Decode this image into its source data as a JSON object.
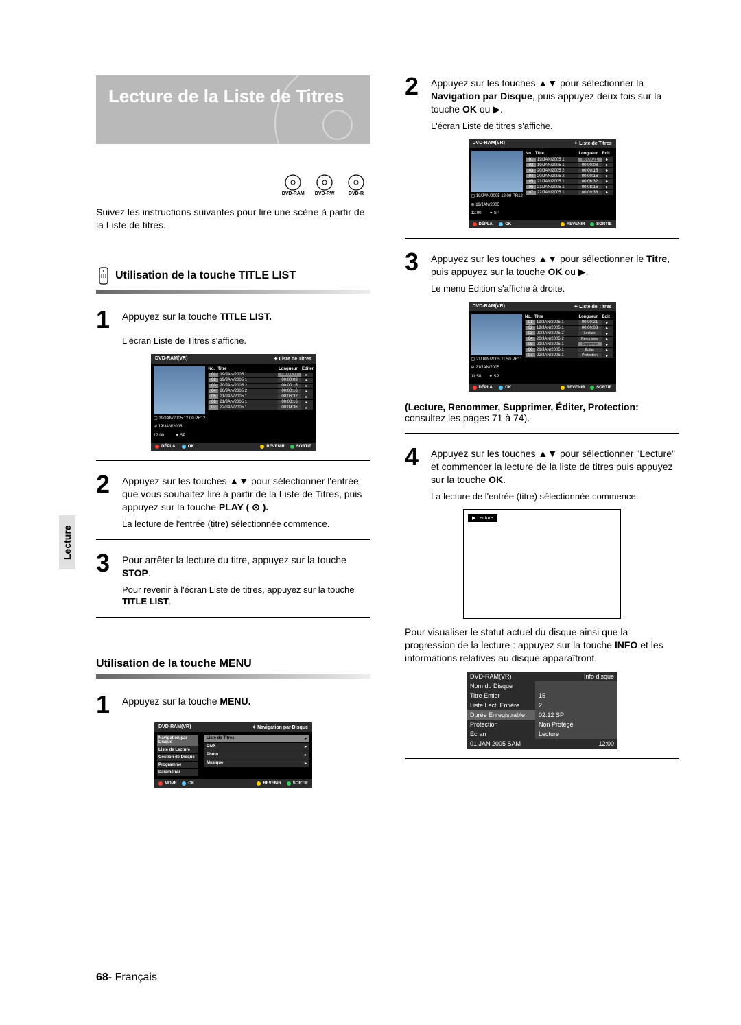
{
  "title": "Lecture de la Liste de Titres",
  "disc_icons": [
    "DVD-RAM",
    "DVD-RW",
    "DVD-R"
  ],
  "intro": "Suivez les instructions suivantes pour lire une scène à partir de la Liste de titres.",
  "section1": {
    "heading": "Utilisation de la touche TITLE LIST",
    "step1_pre": "Appuyez sur la touche ",
    "step1_bold": "TITLE LIST.",
    "step1_sub": "L'écran Liste de Titres s'affiche.",
    "step2": "Appuyez sur les touches ▲▼ pour sélectionner l'entrée que vous souhaitez lire à partir de la Liste de Titres, puis appuyez sur la touche ",
    "step2_bold": "PLAY ( ⊙ ).",
    "step2_sub": "La lecture de l'entrée (titre) sélectionnée commence.",
    "step3_a": "Pour arrêter la lecture du titre, appuyez sur la touche ",
    "step3_bold": "STOP",
    "step3_dot": ".",
    "step3_sub_a": "Pour revenir à l'écran Liste de titres, appuyez sur la touche ",
    "step3_sub_bold": "TITLE LIST",
    "step3_sub_dot": "."
  },
  "section2": {
    "heading": "Utilisation de la touche MENU",
    "step1_pre": "Appuyez sur la touche ",
    "step1_bold": "MENU."
  },
  "right": {
    "step2_a": "Appuyez sur les touches ▲▼ pour sélectionner la ",
    "step2_bold1": "Navigation par Disque",
    "step2_b": ", puis appuyez deux fois sur la touche ",
    "step2_bold2": "OK",
    "step2_c": " ou ▶.",
    "step2_sub": "L'écran Liste de titres s'affiche.",
    "step3_a": "Appuyez sur les touches ▲▼ pour sélectionner le ",
    "step3_bold1": "Titre",
    "step3_b": ", puis appuyez sur la touche ",
    "step3_bold2": "OK",
    "step3_c": " ou ▶.",
    "step3_sub": "Le menu Edition s'affiche à droite.",
    "actions_bold": "(Lecture, Renommer, Supprimer, Éditer, Protection:",
    "actions_rest": " consultez les pages 71 à 74).",
    "step4_a": "Appuyez sur les touches ▲▼ pour sélectionner \"Lecture\" et commencer la lecture de la liste de titres puis appuyez sur la touche ",
    "step4_bold": "OK",
    "step4_dot": ".",
    "step4_sub": "La lecture de l'entrée (titre) sélectionnée commence.",
    "post_play_a": "Pour visualiser le statut actuel du disque ainsi que la progression de la lecture : appuyez sur la touche ",
    "post_play_bold": "INFO",
    "post_play_b": " et les informations relatives au disque apparaîtront."
  },
  "osd_title": {
    "header_left": "DVD-RAM(VR)",
    "header_right": "Liste de Titres",
    "cols": {
      "no": "No.",
      "titre": "Titre",
      "long": "Longueur",
      "edit": "Editer"
    },
    "meta_line1": "19/JAN/2005 12:00 PR12",
    "meta_line2": "19/JAN/2005",
    "meta_line3_a": "12:00",
    "meta_line3_b": "SP",
    "rows": [
      {
        "no": "01",
        "titre": "19/JAN/2005 1",
        "long": "00:00:21",
        "hl": true
      },
      {
        "no": "02",
        "titre": "19/JAN/2005 1",
        "long": "00:00:03"
      },
      {
        "no": "03",
        "titre": "20/JAN/2005 2",
        "long": "00:00:15"
      },
      {
        "no": "04",
        "titre": "20/JAN/2005 2",
        "long": "00:00:16"
      },
      {
        "no": "05",
        "titre": "21/JAN/2005 1",
        "long": "00:06:32"
      },
      {
        "no": "06",
        "titre": "21/JAN/2005 1",
        "long": "00:08:16"
      },
      {
        "no": "07",
        "titre": "22/JAN/2005 1",
        "long": "00:09:36"
      }
    ],
    "foot": {
      "depla": "DÉPLA.",
      "ok": "OK",
      "revenir": "REVENIR",
      "sortie": "SORTIE"
    }
  },
  "osd_title3": {
    "meta_line1": "21/JAN/2005 11:50 PR11",
    "meta_line2": "21/JAN/2005",
    "meta_line3_a": "11:50",
    "rows": [
      {
        "no": "01",
        "titre": "19/JAN/2005 1",
        "long": "00:00:21"
      },
      {
        "no": "02",
        "titre": "19/JAN/2005 1",
        "long": "00:00:03"
      },
      {
        "no": "03",
        "titre": "20/JAN/2005 2",
        "action": "Lecture"
      },
      {
        "no": "04",
        "titre": "20/JAN/2005 2",
        "action": "Renommer"
      },
      {
        "no": "05",
        "titre": "21/JAN/2005 1",
        "action": "Supprimer",
        "hl": true
      },
      {
        "no": "06",
        "titre": "21/JAN/2005 1",
        "action": "Éditer"
      },
      {
        "no": "07",
        "titre": "22/JAN/2005 1",
        "action": "Protection"
      }
    ]
  },
  "osd_nav": {
    "header_left": "DVD-RAM(VR)",
    "header_right": "Navigation par Disque",
    "side": [
      {
        "label": "Navigation par Disque",
        "sel": true
      },
      {
        "label": "Liste de Lecture"
      },
      {
        "label": "Gestion de Disque"
      },
      {
        "label": "Programme"
      },
      {
        "label": "Paramétrer"
      }
    ],
    "main": [
      {
        "label": "Liste de Titres",
        "sel": true
      },
      {
        "label": "DivX"
      },
      {
        "label": "Photo"
      },
      {
        "label": "Musique"
      }
    ],
    "foot": {
      "move": "MOVE",
      "ok": "OK",
      "revenir": "REVENIR",
      "sortie": "SORTIE"
    }
  },
  "playbox_label": "▶ Lecture",
  "infodisc": {
    "top_left": "DVD-RAM(VR)",
    "top_right": "Info disque",
    "rows": [
      {
        "k": "Nom du Disque",
        "v": ""
      },
      {
        "k": "Titre Entier",
        "v": "15"
      },
      {
        "k": "Liste Lect. Entière",
        "v": "2"
      },
      {
        "k": "Durée Enregistrable",
        "v": "02:12  SP",
        "sel": true
      },
      {
        "k": "Protection",
        "v": "Non Protégé"
      },
      {
        "k": "Ecran",
        "v": "Lecture"
      }
    ],
    "bottom_left": "01 JAN 2005 SAM",
    "bottom_right": "12:00"
  },
  "side_tab": "Lecture",
  "footer_page": "68",
  "footer_lang": "- Français"
}
